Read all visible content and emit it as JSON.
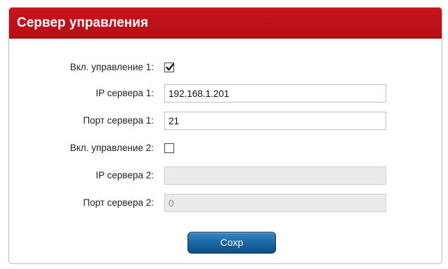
{
  "header": {
    "title": "Сервер управления"
  },
  "form": {
    "enable1": {
      "label": "Вкл. управление 1:",
      "checked": true
    },
    "ip1": {
      "label": "IP сервера 1:",
      "value": "192.168.1.201",
      "disabled": false
    },
    "port1": {
      "label": "Порт сервера 1:",
      "value": "21",
      "disabled": false
    },
    "enable2": {
      "label": "Вкл. управление 2:",
      "checked": false
    },
    "ip2": {
      "label": "IP сервера 2:",
      "value": "",
      "disabled": true
    },
    "port2": {
      "label": "Порт сервера 2:",
      "value": "0",
      "disabled": true
    }
  },
  "actions": {
    "save_label": "Сохр"
  },
  "colors": {
    "header_bg": "#c8141c",
    "button_bg": "#1e6aa6",
    "disabled_field_bg": "#ebebeb"
  }
}
